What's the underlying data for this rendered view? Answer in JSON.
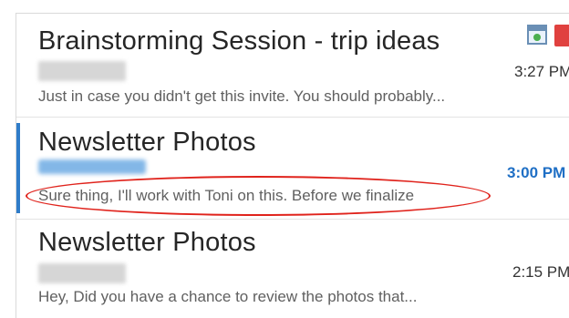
{
  "messages": [
    {
      "subject": "Brainstorming Session - trip ideas",
      "time": "3:27 PM",
      "preview": "Just in case you didn't get this invite. You should probably...",
      "selected": false,
      "icons": [
        "calendar-invite-icon",
        "delete-icon"
      ]
    },
    {
      "subject": "Newsletter Photos",
      "time": "3:00 PM",
      "preview": "Sure thing, I'll work with Toni on this. Before we finalize",
      "selected": true
    },
    {
      "subject": "Newsletter Photos",
      "time": "2:15 PM",
      "preview": "Hey, Did you have a chance to review the photos that...",
      "selected": false
    }
  ],
  "colors": {
    "selection_bar": "#2f7cc9",
    "unread_time": "#1f6fc5",
    "annotation": "#e0231c"
  }
}
